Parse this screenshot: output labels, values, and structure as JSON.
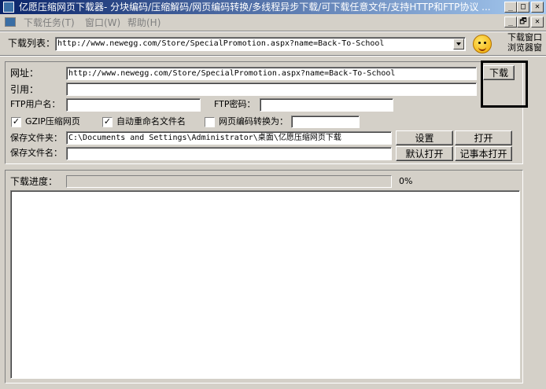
{
  "window": {
    "title": "亿愿压缩网页下载器- 分块编码/压缩解码/网页编码转换/多线程异步下载/可下载任意文件/支持HTTP和FTP协议 ...",
    "minimize_glyph": "_",
    "maximize_glyph": "□",
    "close_glyph": "✕",
    "restore_glyph": "🗗"
  },
  "menu": {
    "items": [
      "下载任务(T)",
      "窗口(W)",
      "帮助(H)"
    ]
  },
  "toolbar": {
    "download_list_label": "下载列表：",
    "download_list_value": "http://www.newegg.com/Store/SpecialPromotion.aspx?name=Back-To-School",
    "side_link_1": "下载窗口",
    "side_link_2": "浏览器窗"
  },
  "form": {
    "url_label": "网址：",
    "url_value": "http://www.newegg.com/Store/SpecialPromotion.aspx?name=Back-To-School",
    "download_button": "下载",
    "referer_label": "引用：",
    "referer_value": "",
    "ftp_user_label": "FTP用户名：",
    "ftp_user_value": "",
    "ftp_pass_label": "FTP密码：",
    "ftp_pass_value": "",
    "gzip_label": "GZIP压缩网页",
    "gzip_checked": true,
    "rename_label": "自动重命名文件名",
    "rename_checked": true,
    "encode_label": "网页编码转换为：",
    "encode_checked": false,
    "encode_value": "",
    "save_folder_label": "保存文件夹：",
    "save_folder_value": "C:\\Documents and Settings\\Administrator\\桌面\\亿愿压缩网页下载",
    "settings_button": "设置",
    "open_button": "打开",
    "save_file_label": "保存文件名：",
    "save_file_value": "",
    "default_open_button": "默认打开",
    "notepad_open_button": "记事本打开",
    "check_glyph": "✓"
  },
  "progress": {
    "label": "下载进度：",
    "value": 0,
    "percent_text": "0%"
  },
  "colors": {
    "title_start": "#0a246a",
    "title_end": "#a6caf0",
    "face": "#d4d0c8"
  }
}
